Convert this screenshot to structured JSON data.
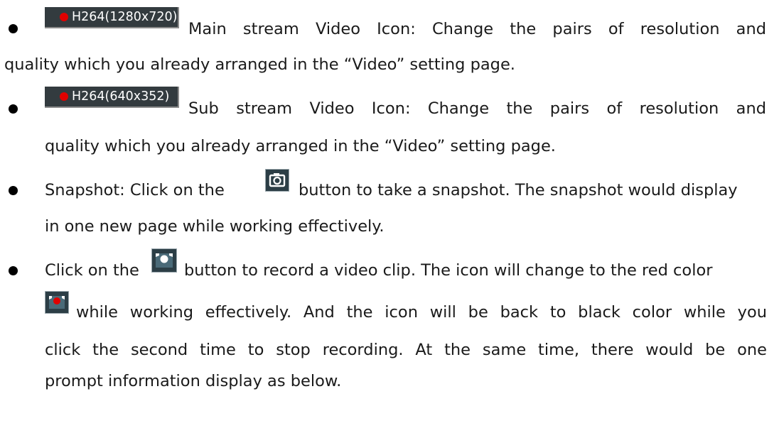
{
  "items": [
    {
      "badge": {
        "codec": "H264(1280x720)"
      },
      "line1": "Main stream Video Icon: Change the pairs of resolution and",
      "line2": "quality which you already arranged in the “Video” setting page."
    },
    {
      "badge": {
        "codec": "H264(640x352)"
      },
      "line1": "Sub stream Video Icon: Change the pairs of resolution and",
      "line2": "quality which you already arranged in the “Video” setting page."
    },
    {
      "icon": "camera-snapshot-icon",
      "line1_before": "Snapshot: Click on the",
      "line1_after": "button to take a snapshot. The snapshot would display",
      "line2": "in one new page while working effectively."
    },
    {
      "icon": "record-icon",
      "icon_active": "record-active-icon",
      "line1_before": "Click on the",
      "line1_after": "button to record a video clip. The icon will change to the red color",
      "line2": "while working effectively. And the icon will be back to black color while you",
      "line3": "click the second time to stop recording. At the same time, there would be one",
      "line4": "prompt information display as below."
    }
  ],
  "colors": {
    "badge_bg": "#333b3f",
    "rec_dot": "#e10000",
    "icon_bg": "#2c3e46"
  }
}
